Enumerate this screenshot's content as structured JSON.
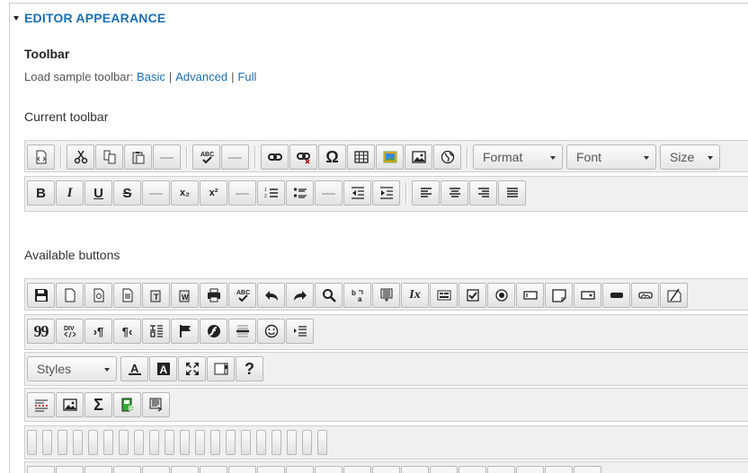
{
  "section": {
    "title": "EDITOR APPEARANCE"
  },
  "toolbar": {
    "heading": "Toolbar",
    "sample_prefix": "Load sample toolbar:",
    "sample_links": [
      "Basic",
      "Advanced",
      "Full"
    ],
    "sample_sep": "|"
  },
  "current": {
    "heading": "Current toolbar",
    "combos": {
      "format": "Format",
      "font": "Font",
      "size": "Size"
    }
  },
  "available": {
    "heading": "Available buttons",
    "styles_combo": "Styles",
    "glyphs": {
      "omega": "Ω",
      "bold": "B",
      "italic": "I",
      "underline": "U",
      "strike": "S",
      "subscript": "x₂",
      "superscript": "x²",
      "quote": "99",
      "help": "?",
      "sigma": "Σ",
      "abc": "ABC",
      "div": "DIV",
      "separator_dash": "—",
      "text_color": "A",
      "bg_color": "A",
      "ltr": "›¶",
      "rtl": "¶‹",
      "clear_format": "Ix"
    }
  }
}
